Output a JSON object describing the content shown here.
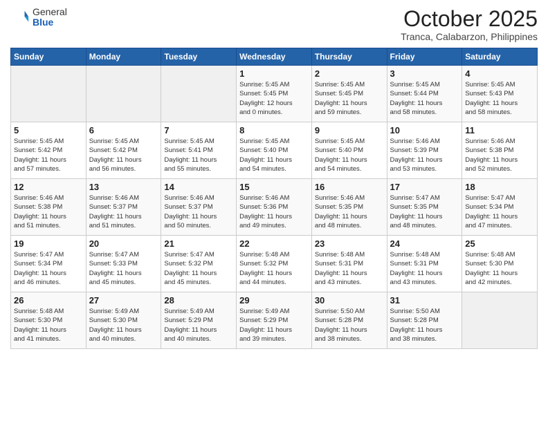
{
  "header": {
    "logo_general": "General",
    "logo_blue": "Blue",
    "month": "October 2025",
    "location": "Tranca, Calabarzon, Philippines"
  },
  "days_of_week": [
    "Sunday",
    "Monday",
    "Tuesday",
    "Wednesday",
    "Thursday",
    "Friday",
    "Saturday"
  ],
  "weeks": [
    [
      {
        "day": "",
        "content": ""
      },
      {
        "day": "",
        "content": ""
      },
      {
        "day": "",
        "content": ""
      },
      {
        "day": "1",
        "content": "Sunrise: 5:45 AM\nSunset: 5:45 PM\nDaylight: 12 hours\nand 0 minutes."
      },
      {
        "day": "2",
        "content": "Sunrise: 5:45 AM\nSunset: 5:45 PM\nDaylight: 11 hours\nand 59 minutes."
      },
      {
        "day": "3",
        "content": "Sunrise: 5:45 AM\nSunset: 5:44 PM\nDaylight: 11 hours\nand 58 minutes."
      },
      {
        "day": "4",
        "content": "Sunrise: 5:45 AM\nSunset: 5:43 PM\nDaylight: 11 hours\nand 58 minutes."
      }
    ],
    [
      {
        "day": "5",
        "content": "Sunrise: 5:45 AM\nSunset: 5:42 PM\nDaylight: 11 hours\nand 57 minutes."
      },
      {
        "day": "6",
        "content": "Sunrise: 5:45 AM\nSunset: 5:42 PM\nDaylight: 11 hours\nand 56 minutes."
      },
      {
        "day": "7",
        "content": "Sunrise: 5:45 AM\nSunset: 5:41 PM\nDaylight: 11 hours\nand 55 minutes."
      },
      {
        "day": "8",
        "content": "Sunrise: 5:45 AM\nSunset: 5:40 PM\nDaylight: 11 hours\nand 54 minutes."
      },
      {
        "day": "9",
        "content": "Sunrise: 5:45 AM\nSunset: 5:40 PM\nDaylight: 11 hours\nand 54 minutes."
      },
      {
        "day": "10",
        "content": "Sunrise: 5:46 AM\nSunset: 5:39 PM\nDaylight: 11 hours\nand 53 minutes."
      },
      {
        "day": "11",
        "content": "Sunrise: 5:46 AM\nSunset: 5:38 PM\nDaylight: 11 hours\nand 52 minutes."
      }
    ],
    [
      {
        "day": "12",
        "content": "Sunrise: 5:46 AM\nSunset: 5:38 PM\nDaylight: 11 hours\nand 51 minutes."
      },
      {
        "day": "13",
        "content": "Sunrise: 5:46 AM\nSunset: 5:37 PM\nDaylight: 11 hours\nand 51 minutes."
      },
      {
        "day": "14",
        "content": "Sunrise: 5:46 AM\nSunset: 5:37 PM\nDaylight: 11 hours\nand 50 minutes."
      },
      {
        "day": "15",
        "content": "Sunrise: 5:46 AM\nSunset: 5:36 PM\nDaylight: 11 hours\nand 49 minutes."
      },
      {
        "day": "16",
        "content": "Sunrise: 5:46 AM\nSunset: 5:35 PM\nDaylight: 11 hours\nand 48 minutes."
      },
      {
        "day": "17",
        "content": "Sunrise: 5:47 AM\nSunset: 5:35 PM\nDaylight: 11 hours\nand 48 minutes."
      },
      {
        "day": "18",
        "content": "Sunrise: 5:47 AM\nSunset: 5:34 PM\nDaylight: 11 hours\nand 47 minutes."
      }
    ],
    [
      {
        "day": "19",
        "content": "Sunrise: 5:47 AM\nSunset: 5:34 PM\nDaylight: 11 hours\nand 46 minutes."
      },
      {
        "day": "20",
        "content": "Sunrise: 5:47 AM\nSunset: 5:33 PM\nDaylight: 11 hours\nand 45 minutes."
      },
      {
        "day": "21",
        "content": "Sunrise: 5:47 AM\nSunset: 5:32 PM\nDaylight: 11 hours\nand 45 minutes."
      },
      {
        "day": "22",
        "content": "Sunrise: 5:48 AM\nSunset: 5:32 PM\nDaylight: 11 hours\nand 44 minutes."
      },
      {
        "day": "23",
        "content": "Sunrise: 5:48 AM\nSunset: 5:31 PM\nDaylight: 11 hours\nand 43 minutes."
      },
      {
        "day": "24",
        "content": "Sunrise: 5:48 AM\nSunset: 5:31 PM\nDaylight: 11 hours\nand 43 minutes."
      },
      {
        "day": "25",
        "content": "Sunrise: 5:48 AM\nSunset: 5:30 PM\nDaylight: 11 hours\nand 42 minutes."
      }
    ],
    [
      {
        "day": "26",
        "content": "Sunrise: 5:48 AM\nSunset: 5:30 PM\nDaylight: 11 hours\nand 41 minutes."
      },
      {
        "day": "27",
        "content": "Sunrise: 5:49 AM\nSunset: 5:30 PM\nDaylight: 11 hours\nand 40 minutes."
      },
      {
        "day": "28",
        "content": "Sunrise: 5:49 AM\nSunset: 5:29 PM\nDaylight: 11 hours\nand 40 minutes."
      },
      {
        "day": "29",
        "content": "Sunrise: 5:49 AM\nSunset: 5:29 PM\nDaylight: 11 hours\nand 39 minutes."
      },
      {
        "day": "30",
        "content": "Sunrise: 5:50 AM\nSunset: 5:28 PM\nDaylight: 11 hours\nand 38 minutes."
      },
      {
        "day": "31",
        "content": "Sunrise: 5:50 AM\nSunset: 5:28 PM\nDaylight: 11 hours\nand 38 minutes."
      },
      {
        "day": "",
        "content": ""
      }
    ]
  ]
}
